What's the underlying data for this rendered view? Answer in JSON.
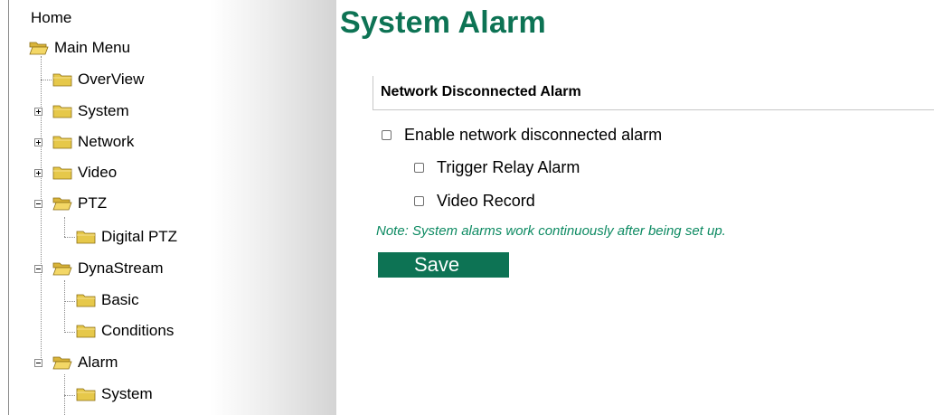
{
  "sidebar": {
    "home": "Home",
    "items": [
      {
        "label": "Main Menu"
      },
      {
        "label": "OverView"
      },
      {
        "label": "System"
      },
      {
        "label": "Network"
      },
      {
        "label": "Video"
      },
      {
        "label": "PTZ"
      },
      {
        "label": "Digital PTZ"
      },
      {
        "label": "DynaStream"
      },
      {
        "label": "Basic"
      },
      {
        "label": "Conditions"
      },
      {
        "label": "Alarm"
      },
      {
        "label": "System"
      }
    ]
  },
  "main": {
    "title": "System Alarm",
    "section_header": "Network Disconnected Alarm",
    "options": {
      "enable": {
        "label": "Enable network disconnected alarm",
        "checked": false
      },
      "relay": {
        "label": "Trigger Relay Alarm",
        "checked": false
      },
      "video": {
        "label": "Video Record",
        "checked": false
      }
    },
    "note": "Note: System alarms work continuously after being set up.",
    "save_label": "Save"
  },
  "colors": {
    "accent": "#0d7354",
    "note_text": "#0d8a62",
    "folder": "#e6c84a"
  },
  "icons": {
    "folder": "folder-icon",
    "folder_open": "folder-open-icon",
    "expand": "expand-plus-icon",
    "collapse": "collapse-minus-icon"
  }
}
